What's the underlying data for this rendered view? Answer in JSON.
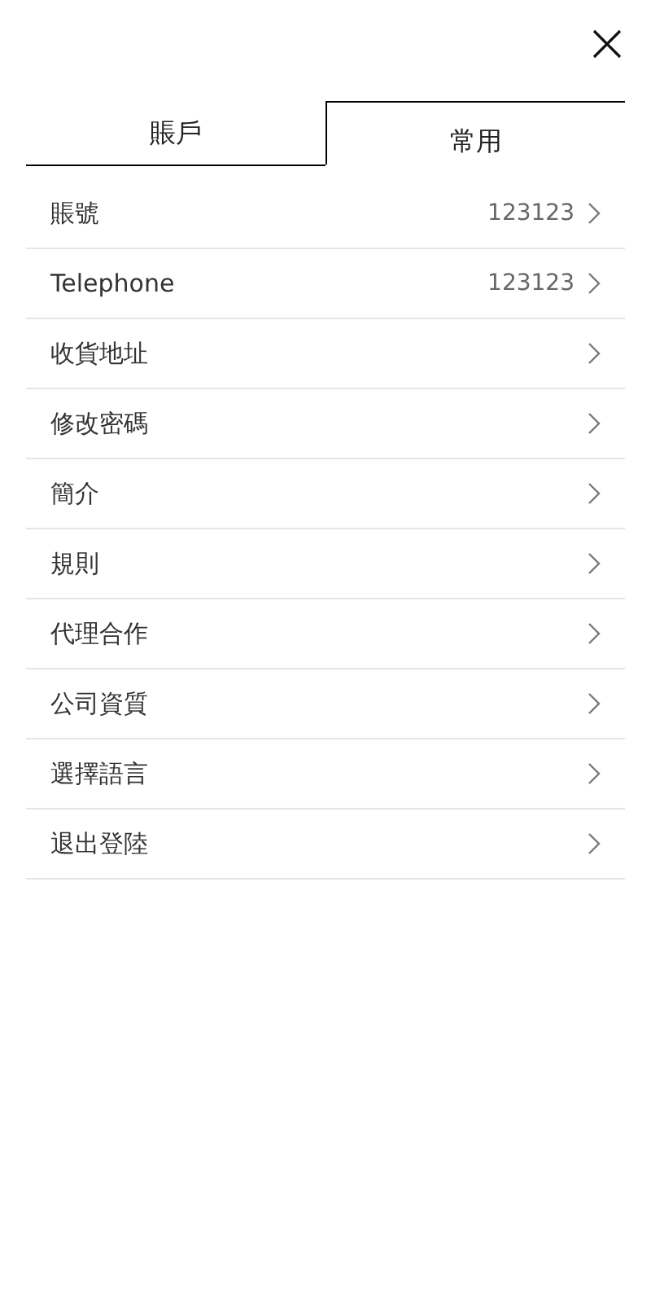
{
  "tabs": [
    {
      "label": "賬戶",
      "selected": false
    },
    {
      "label": "常用",
      "selected": true
    }
  ],
  "menu": [
    {
      "label": "賬號",
      "value": "123123"
    },
    {
      "label": "Telephone",
      "value": "123123"
    },
    {
      "label": "收貨地址"
    },
    {
      "label": "修改密碼"
    },
    {
      "label": "簡介"
    },
    {
      "label": "規則"
    },
    {
      "label": "代理合作"
    },
    {
      "label": "公司資質"
    },
    {
      "label": "選擇語言"
    },
    {
      "label": "退出登陸"
    }
  ]
}
